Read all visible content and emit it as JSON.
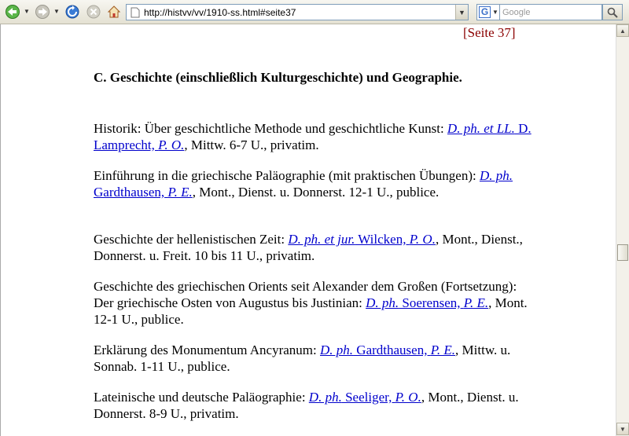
{
  "browser": {
    "url": "http://histvv/vv/1910-ss.html#seite37",
    "search_placeholder": "Google",
    "search_engine_letter": "G"
  },
  "page": {
    "seite_label": "[Seite 37]",
    "heading": "C. Geschichte (einschließlich Kulturgeschichte) und Geographie.",
    "entries": [
      {
        "pre": "Historik: Über geschichtliche Methode und geschichtliche Kunst: ",
        "link_italic": "D. ph. et LL.",
        "link_name": " D. Lamprecht, ",
        "link_rank": "P. O.",
        "post": ", Mittw. 6-7 U., privatim."
      },
      {
        "pre": "Einführung in die griechische Paläographie (mit praktischen Übungen): ",
        "link_italic": "D. ph.",
        "link_name": " Gardthausen, ",
        "link_rank": "P. E.",
        "post": ", Mont., Dienst. u. Donnerst. 12-1 U., publice."
      },
      {
        "pre": "Geschichte der hellenistischen Zeit: ",
        "link_italic": "D. ph. et jur.",
        "link_name": " Wilcken, ",
        "link_rank": "P. O.",
        "post": ", Mont., Dienst., Donnerst. u. Freit. 10 bis 11 U., privatim."
      },
      {
        "pre": "Geschichte des griechischen Orients seit Alexander dem Großen (Fortsetzung): Der griechische Osten von Augustus bis Justinian: ",
        "link_italic": "D. ph.",
        "link_name": " Soerensen, ",
        "link_rank": "P. E.",
        "post": ", Mont. 12-1 U., publice."
      },
      {
        "pre": "Erklärung des Monumentum Ancyranum: ",
        "link_italic": "D. ph.",
        "link_name": " Gardthausen, ",
        "link_rank": "P. E.",
        "post": ", Mittw. u. Sonnab. 1-11 U., publice."
      },
      {
        "pre": "Lateinische und deutsche Paläographie: ",
        "link_italic": "D. ph.",
        "link_name": " Seeliger, ",
        "link_rank": "P. O.",
        "post": ", Mont., Dienst. u. Donnerst. 8-9 U., privatim."
      }
    ]
  }
}
